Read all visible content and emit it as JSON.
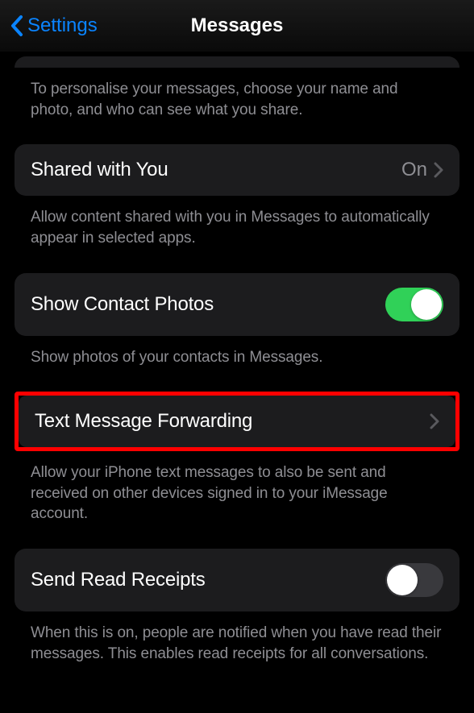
{
  "header": {
    "back_label": "Settings",
    "title": "Messages"
  },
  "groups": {
    "personalize": {
      "footer": "To personalise your messages, choose your name and photo, and who can see what you share."
    },
    "shared": {
      "label": "Shared with You",
      "value": "On",
      "footer": "Allow content shared with you in Messages to automatically appear in selected apps."
    },
    "contact_photos": {
      "label": "Show Contact Photos",
      "footer": "Show photos of your contacts in Messages."
    },
    "forwarding": {
      "label": "Text Message Forwarding",
      "footer": "Allow your iPhone text messages to also be sent and received on other devices signed in to your iMessage account."
    },
    "read_receipts": {
      "label": "Send Read Receipts",
      "footer": "When this is on, people are notified when you have read their messages. This enables read receipts for all conversations."
    }
  },
  "colors": {
    "link": "#0a84ff",
    "toggle_on": "#30d158",
    "highlight": "#ff0000"
  }
}
